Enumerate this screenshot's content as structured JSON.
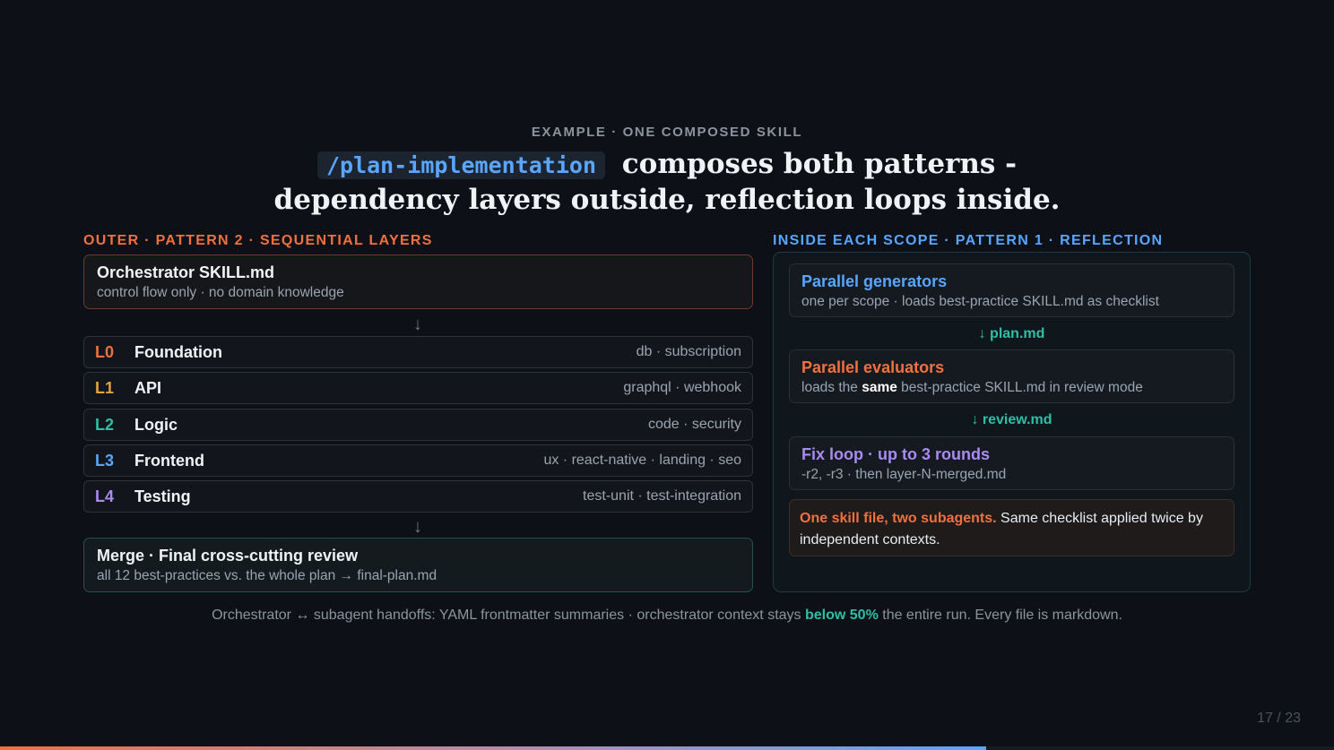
{
  "eyebrow": "EXAMPLE · ONE COMPOSED SKILL",
  "headline": {
    "code": "/plan-implementation",
    "line1_rest": " composes both patterns -",
    "line2": "dependency layers outside, reflection loops inside."
  },
  "left": {
    "label": "OUTER · PATTERN 2 · SEQUENTIAL LAYERS",
    "orchestrator": {
      "title": "Orchestrator SKILL.md",
      "sub": "control flow only · no domain knowledge"
    },
    "arrow": "↓",
    "layers": [
      {
        "code": "L0",
        "name": "Foundation",
        "tags": "db · subscription",
        "color": "#f0713f"
      },
      {
        "code": "L1",
        "name": "API",
        "tags": "graphql · webhook",
        "color": "#e3a33a"
      },
      {
        "code": "L2",
        "name": "Logic",
        "tags": "code · security",
        "color": "#2fbfa4"
      },
      {
        "code": "L3",
        "name": "Frontend",
        "tags": "ux · react-native · landing · seo",
        "color": "#58a6ff"
      },
      {
        "code": "L4",
        "name": "Testing",
        "tags": "test-unit · test-integration",
        "color": "#a98bf0"
      }
    ],
    "merge": {
      "title": "Merge · Final cross-cutting review",
      "sub": "all 12 best-practices vs. the whole plan → final-plan.md"
    }
  },
  "right": {
    "label": "INSIDE EACH SCOPE · PATTERN 1 · REFLECTION",
    "generators": {
      "title": "Parallel generators",
      "sub": "one per scope · loads best-practice SKILL.md as checklist",
      "color": "#58a6ff"
    },
    "flow1": "↓ plan.md",
    "evaluators": {
      "title": "Parallel evaluators",
      "sub_pre": "loads the ",
      "sub_bold": "same",
      "sub_post": " best-practice SKILL.md in review mode",
      "color": "#f0713f"
    },
    "flow2": "↓ review.md",
    "fixloop": {
      "title": "Fix loop · up to 3 rounds",
      "sub": "-r2, -r3 · then layer-N-merged.md",
      "color": "#a98bf0"
    },
    "callout": {
      "highlight": "One skill file, two subagents.",
      "rest": " Same checklist applied twice by independent contexts."
    }
  },
  "footer": {
    "pre": "Orchestrator ↔ subagent handoffs: YAML frontmatter summaries · orchestrator context stays ",
    "highlight": "below 50%",
    "post": " the entire run. Every file is markdown."
  },
  "page": {
    "label": "17 / 23",
    "progress": 0.739
  },
  "colors": {
    "accent_orange": "#f0713f",
    "accent_blue": "#58a6ff",
    "accent_teal": "#2fbfa4",
    "accent_purple": "#a98bf0",
    "background": "#0d1117"
  }
}
